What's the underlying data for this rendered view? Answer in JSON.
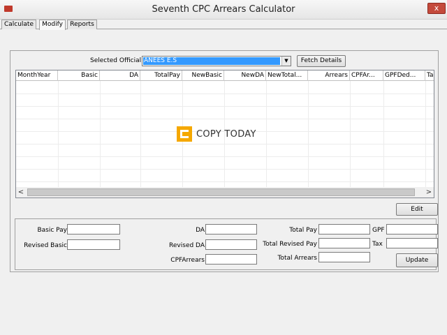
{
  "window": {
    "title": "Seventh CPC Arrears Calculator",
    "close_glyph": "x"
  },
  "tabs": [
    {
      "label": "Calculate"
    },
    {
      "label": "Modify"
    },
    {
      "label": "Reports"
    }
  ],
  "selector": {
    "label": "Selected Official",
    "value": "ANEES E.S",
    "dropdown_glyph": "▼",
    "fetch_button": "Fetch Details"
  },
  "grid": {
    "columns": [
      "MonthYear",
      "Basic",
      "DA",
      "TotalPay",
      "NewBasic",
      "NewDA",
      "NewTotal...",
      "Arrears",
      "CPFAr...",
      "GPFDed...",
      "Ta"
    ],
    "scroll_left": "<",
    "scroll_right": ">"
  },
  "watermark": {
    "text": "COPY TODAY"
  },
  "edit_button": "Edit",
  "form": {
    "basic_pay": "Basic Pay",
    "revised_basic": "Revised Basic",
    "da": "DA",
    "revised_da": "Revised DA",
    "cpf_arrears": "CPFArrears",
    "total_pay": "Total Pay",
    "total_revised_pay": "Total Revised Pay",
    "total_arrears": "Total Arrears",
    "gpf": "GPF",
    "tax": "Tax",
    "update_button": "Update"
  }
}
